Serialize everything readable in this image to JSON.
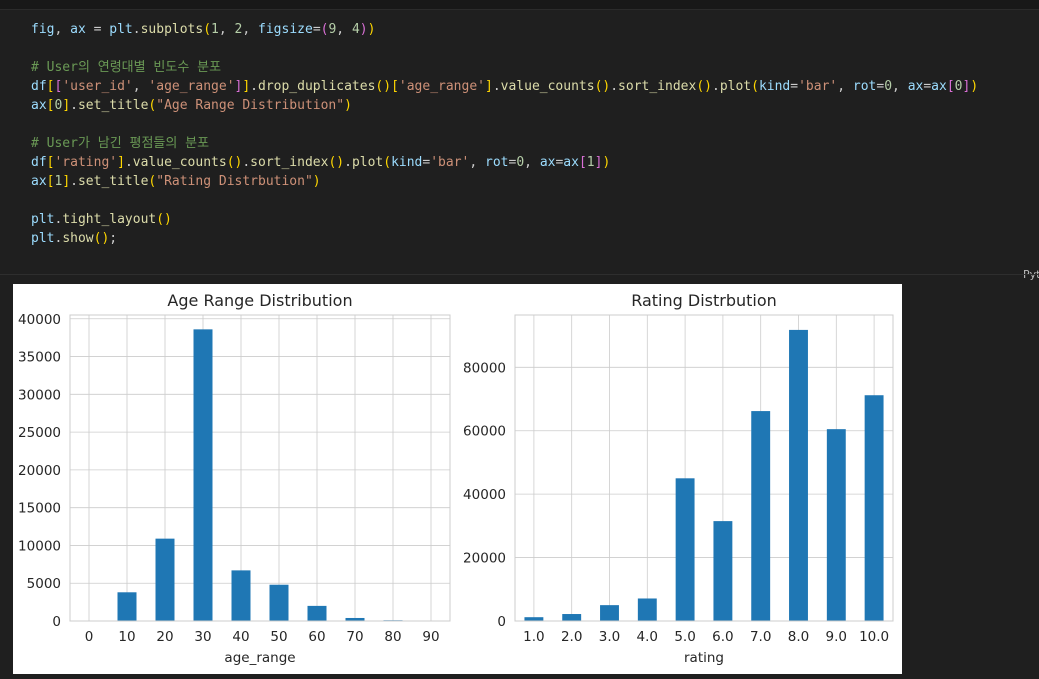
{
  "code": {
    "lines": [
      [
        [
          "fig",
          "t-ident"
        ],
        [
          ", ",
          "t-punc"
        ],
        [
          "ax",
          "t-ident"
        ],
        [
          " = ",
          "t-punc"
        ],
        [
          "plt",
          "t-ident"
        ],
        [
          ".",
          "t-punc"
        ],
        [
          "subplots",
          "t-func"
        ],
        [
          "(",
          "t-b1"
        ],
        [
          "1",
          "t-num"
        ],
        [
          ", ",
          "t-punc"
        ],
        [
          "2",
          "t-num"
        ],
        [
          ", ",
          "t-punc"
        ],
        [
          "figsize",
          "t-kw"
        ],
        [
          "=",
          "t-punc"
        ],
        [
          "(",
          "t-b2"
        ],
        [
          "9",
          "t-num"
        ],
        [
          ", ",
          "t-punc"
        ],
        [
          "4",
          "t-num"
        ],
        [
          ")",
          "t-b2"
        ],
        [
          ")",
          "t-b1"
        ]
      ],
      [],
      [
        [
          "# User의 연령대별 빈도수 분포",
          "t-com"
        ]
      ],
      [
        [
          "df",
          "t-ident"
        ],
        [
          "[",
          "t-b1"
        ],
        [
          "[",
          "t-b2"
        ],
        [
          "'user_id'",
          "t-str"
        ],
        [
          ", ",
          "t-punc"
        ],
        [
          "'age_range'",
          "t-str"
        ],
        [
          "]",
          "t-b2"
        ],
        [
          "]",
          "t-b1"
        ],
        [
          ".",
          "t-punc"
        ],
        [
          "drop_duplicates",
          "t-func"
        ],
        [
          "()",
          "t-b1"
        ],
        [
          "[",
          "t-b1"
        ],
        [
          "'age_range'",
          "t-str"
        ],
        [
          "]",
          "t-b1"
        ],
        [
          ".",
          "t-punc"
        ],
        [
          "value_counts",
          "t-func"
        ],
        [
          "()",
          "t-b1"
        ],
        [
          ".",
          "t-punc"
        ],
        [
          "sort_index",
          "t-func"
        ],
        [
          "()",
          "t-b1"
        ],
        [
          ".",
          "t-punc"
        ],
        [
          "plot",
          "t-func"
        ],
        [
          "(",
          "t-b1"
        ],
        [
          "kind",
          "t-kw"
        ],
        [
          "=",
          "t-punc"
        ],
        [
          "'bar'",
          "t-str"
        ],
        [
          ", ",
          "t-punc"
        ],
        [
          "rot",
          "t-kw"
        ],
        [
          "=",
          "t-punc"
        ],
        [
          "0",
          "t-num"
        ],
        [
          ", ",
          "t-punc"
        ],
        [
          "ax",
          "t-kw"
        ],
        [
          "=",
          "t-punc"
        ],
        [
          "ax",
          "t-ident"
        ],
        [
          "[",
          "t-b2"
        ],
        [
          "0",
          "t-num"
        ],
        [
          "]",
          "t-b2"
        ],
        [
          ")",
          "t-b1"
        ]
      ],
      [
        [
          "ax",
          "t-ident"
        ],
        [
          "[",
          "t-b1"
        ],
        [
          "0",
          "t-num"
        ],
        [
          "]",
          "t-b1"
        ],
        [
          ".",
          "t-punc"
        ],
        [
          "set_title",
          "t-func"
        ],
        [
          "(",
          "t-b1"
        ],
        [
          "\"Age Range Distribution\"",
          "t-str"
        ],
        [
          ")",
          "t-b1"
        ]
      ],
      [],
      [
        [
          "# User가 남긴 평점들의 분포",
          "t-com"
        ]
      ],
      [
        [
          "df",
          "t-ident"
        ],
        [
          "[",
          "t-b1"
        ],
        [
          "'rating'",
          "t-str"
        ],
        [
          "]",
          "t-b1"
        ],
        [
          ".",
          "t-punc"
        ],
        [
          "value_counts",
          "t-func"
        ],
        [
          "()",
          "t-b1"
        ],
        [
          ".",
          "t-punc"
        ],
        [
          "sort_index",
          "t-func"
        ],
        [
          "()",
          "t-b1"
        ],
        [
          ".",
          "t-punc"
        ],
        [
          "plot",
          "t-func"
        ],
        [
          "(",
          "t-b1"
        ],
        [
          "kind",
          "t-kw"
        ],
        [
          "=",
          "t-punc"
        ],
        [
          "'bar'",
          "t-str"
        ],
        [
          ", ",
          "t-punc"
        ],
        [
          "rot",
          "t-kw"
        ],
        [
          "=",
          "t-punc"
        ],
        [
          "0",
          "t-num"
        ],
        [
          ", ",
          "t-punc"
        ],
        [
          "ax",
          "t-kw"
        ],
        [
          "=",
          "t-punc"
        ],
        [
          "ax",
          "t-ident"
        ],
        [
          "[",
          "t-b2"
        ],
        [
          "1",
          "t-num"
        ],
        [
          "]",
          "t-b2"
        ],
        [
          ")",
          "t-b1"
        ]
      ],
      [
        [
          "ax",
          "t-ident"
        ],
        [
          "[",
          "t-b1"
        ],
        [
          "1",
          "t-num"
        ],
        [
          "]",
          "t-b1"
        ],
        [
          ".",
          "t-punc"
        ],
        [
          "set_title",
          "t-func"
        ],
        [
          "(",
          "t-b1"
        ],
        [
          "\"Rating Distrbution\"",
          "t-str"
        ],
        [
          ")",
          "t-b1"
        ]
      ],
      [],
      [
        [
          "plt",
          "t-ident"
        ],
        [
          ".",
          "t-punc"
        ],
        [
          "tight_layout",
          "t-func"
        ],
        [
          "()",
          "t-b1"
        ]
      ],
      [
        [
          "plt",
          "t-ident"
        ],
        [
          ".",
          "t-punc"
        ],
        [
          "show",
          "t-func"
        ],
        [
          "()",
          "t-b1"
        ],
        [
          ";",
          "t-punc"
        ]
      ]
    ],
    "language_label": "Pyt"
  },
  "colors": {
    "bar": "#1f77b4",
    "grid": "#cccccc",
    "axes_edge": "#cccccc",
    "text": "#262626"
  },
  "chart_data": [
    {
      "type": "bar",
      "title": "Age Range Distribution",
      "xlabel": "age_range",
      "ylabel": "",
      "categories": [
        "0",
        "10",
        "20",
        "30",
        "40",
        "50",
        "60",
        "70",
        "80",
        "90"
      ],
      "values": [
        50,
        3800,
        10900,
        38600,
        6700,
        4800,
        2000,
        400,
        100,
        50
      ],
      "ylim": [
        0,
        40500
      ],
      "yticks": [
        0,
        5000,
        10000,
        15000,
        20000,
        25000,
        30000,
        35000,
        40000
      ],
      "grid": true
    },
    {
      "type": "bar",
      "title": "Rating Distrbution",
      "xlabel": "rating",
      "ylabel": "",
      "categories": [
        "1.0",
        "2.0",
        "3.0",
        "4.0",
        "5.0",
        "6.0",
        "7.0",
        "8.0",
        "9.0",
        "10.0"
      ],
      "values": [
        1200,
        2200,
        5000,
        7100,
        45000,
        31500,
        66200,
        91800,
        60500,
        71200
      ],
      "ylim": [
        0,
        96500
      ],
      "yticks": [
        0,
        20000,
        40000,
        60000,
        80000
      ],
      "grid": true
    }
  ]
}
